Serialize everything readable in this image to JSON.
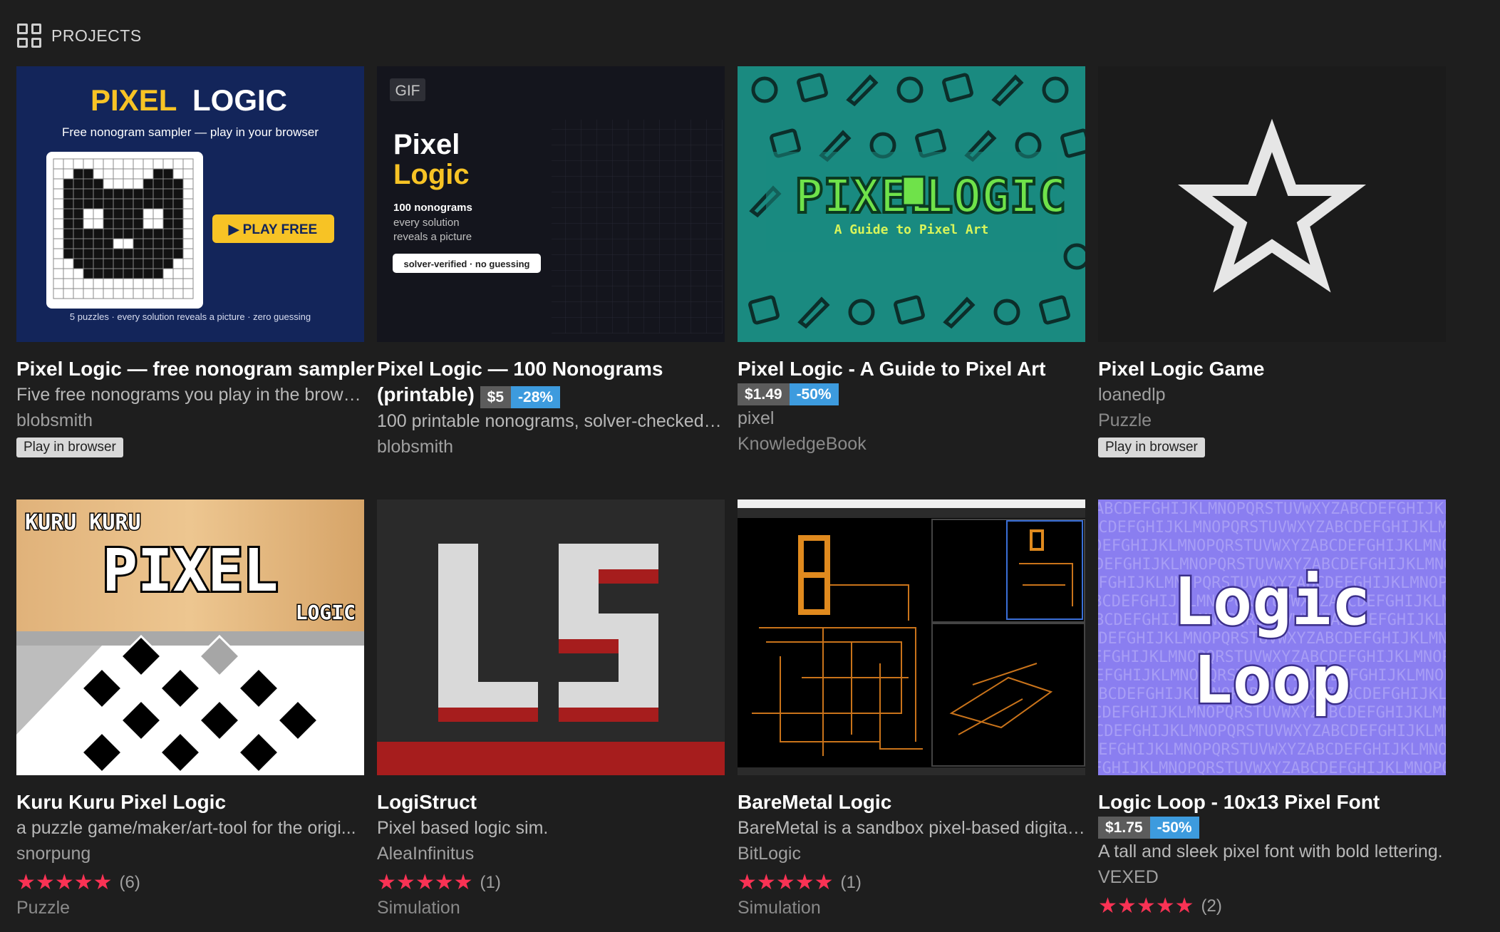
{
  "header": {
    "title": "PROJECTS",
    "icon": "grid-icon"
  },
  "colors": {
    "background": "#1e1e1e",
    "price_bg": "#5c5c5c",
    "discount_bg": "#3d9bde",
    "star": "#fa3254"
  },
  "cards": [
    {
      "title": "Pixel Logic — free nonogram sampler",
      "desc": "Five free nonograms you play in the brows...",
      "author": "blobsmith",
      "badge": "Play in browser",
      "thumb": {
        "heading_a": "PIXEL",
        "heading_b": "LOGIC",
        "subtitle": "Free nonogram sampler — play in your browser",
        "button": "▶ PLAY FREE",
        "footer": "5 puzzles · every solution reveals a picture · zero guessing"
      }
    },
    {
      "title": "Pixel Logic — 100 Nonograms",
      "title2": "(printable)",
      "price": "$5",
      "discount": "-28%",
      "desc": "100 printable nonograms, solver-checked: ...",
      "author": "blobsmith",
      "thumb": {
        "gif": "GIF",
        "line1": "Pixel",
        "line2": "Logic",
        "count": "100 nonograms",
        "sub1": "every solution",
        "sub2": "reveals a picture",
        "pill": "solver-verified · no guessing"
      }
    },
    {
      "title": "Pixel Logic - A Guide to Pixel Art",
      "price": "$1.49",
      "discount": "-50%",
      "author": "pixel",
      "tag": "KnowledgeBook",
      "thumb": {
        "logo_a": "PIXEL",
        "logo_b": "LOGIC",
        "tagline": "A Guide to Pixel Art"
      }
    },
    {
      "title": "Pixel Logic Game",
      "author": "loanedlp",
      "tag": "Puzzle",
      "badge": "Play in browser"
    },
    {
      "title": "Kuru Kuru Pixel Logic",
      "desc": "a puzzle game/maker/art-tool for the origi...",
      "author": "snorpung",
      "rating": 5,
      "rating_count": "(6)",
      "tag": "Puzzle",
      "thumb": {
        "top": "KURU KURU",
        "mid": "PIXEL",
        "bottom": "LOGIC"
      }
    },
    {
      "title": "LogiStruct",
      "desc": "Pixel based logic sim.",
      "author": "AleaInfinitus",
      "rating": 5,
      "rating_count": "(1)",
      "tag": "Simulation"
    },
    {
      "title": "BareMetal Logic",
      "desc": "BareMetal is a sandbox pixel-based digital l...",
      "author": "BitLogic",
      "rating": 5,
      "rating_count": "(1)",
      "tag": "Simulation"
    },
    {
      "title": "Logic Loop - 10x13 Pixel Font",
      "price": "$1.75",
      "discount": "-50%",
      "desc": "A tall and sleek pixel font with bold lettering.",
      "author": "VEXED",
      "rating": 5,
      "rating_count": "(2)",
      "thumb": {
        "line1": "Logic",
        "line2": "Loop",
        "bg_text": "ABCDEFGHIJKLMNOPQRSTUVWXYZABCDEFGHIJKLMNOPQRSTUVWXYZ"
      }
    }
  ]
}
